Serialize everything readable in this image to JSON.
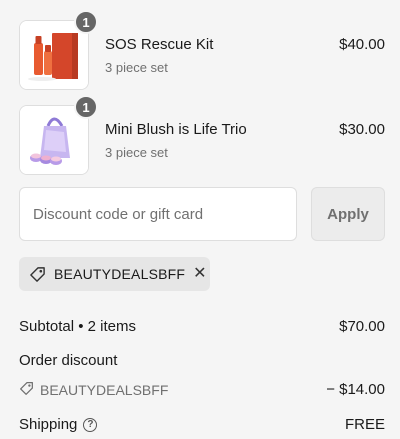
{
  "items": [
    {
      "name": "SOS Rescue Kit",
      "subtitle": "3 piece set",
      "price": "$40.00",
      "quantity": "1",
      "image_icon": "product-image-icon"
    },
    {
      "name": "Mini Blush is Life Trio",
      "subtitle": "3 piece set",
      "price": "$30.00",
      "quantity": "1",
      "image_icon": "product-image-icon"
    }
  ],
  "discount": {
    "placeholder": "Discount code or gift card",
    "apply_label": "Apply",
    "applied_code": "BEAUTYDEALSBFF",
    "remove_symbol": "✕"
  },
  "summary": {
    "subtotal_label": "Subtotal • 2 items",
    "subtotal_value": "$70.00",
    "order_discount_label": "Order discount",
    "discount_code": "BEAUTYDEALSBFF",
    "discount_value": "− $14.00",
    "shipping_label": "Shipping",
    "shipping_value": "FREE"
  },
  "colors": {
    "background": "#f5f5f5",
    "badge": "#666666",
    "muted_text": "#707070"
  }
}
